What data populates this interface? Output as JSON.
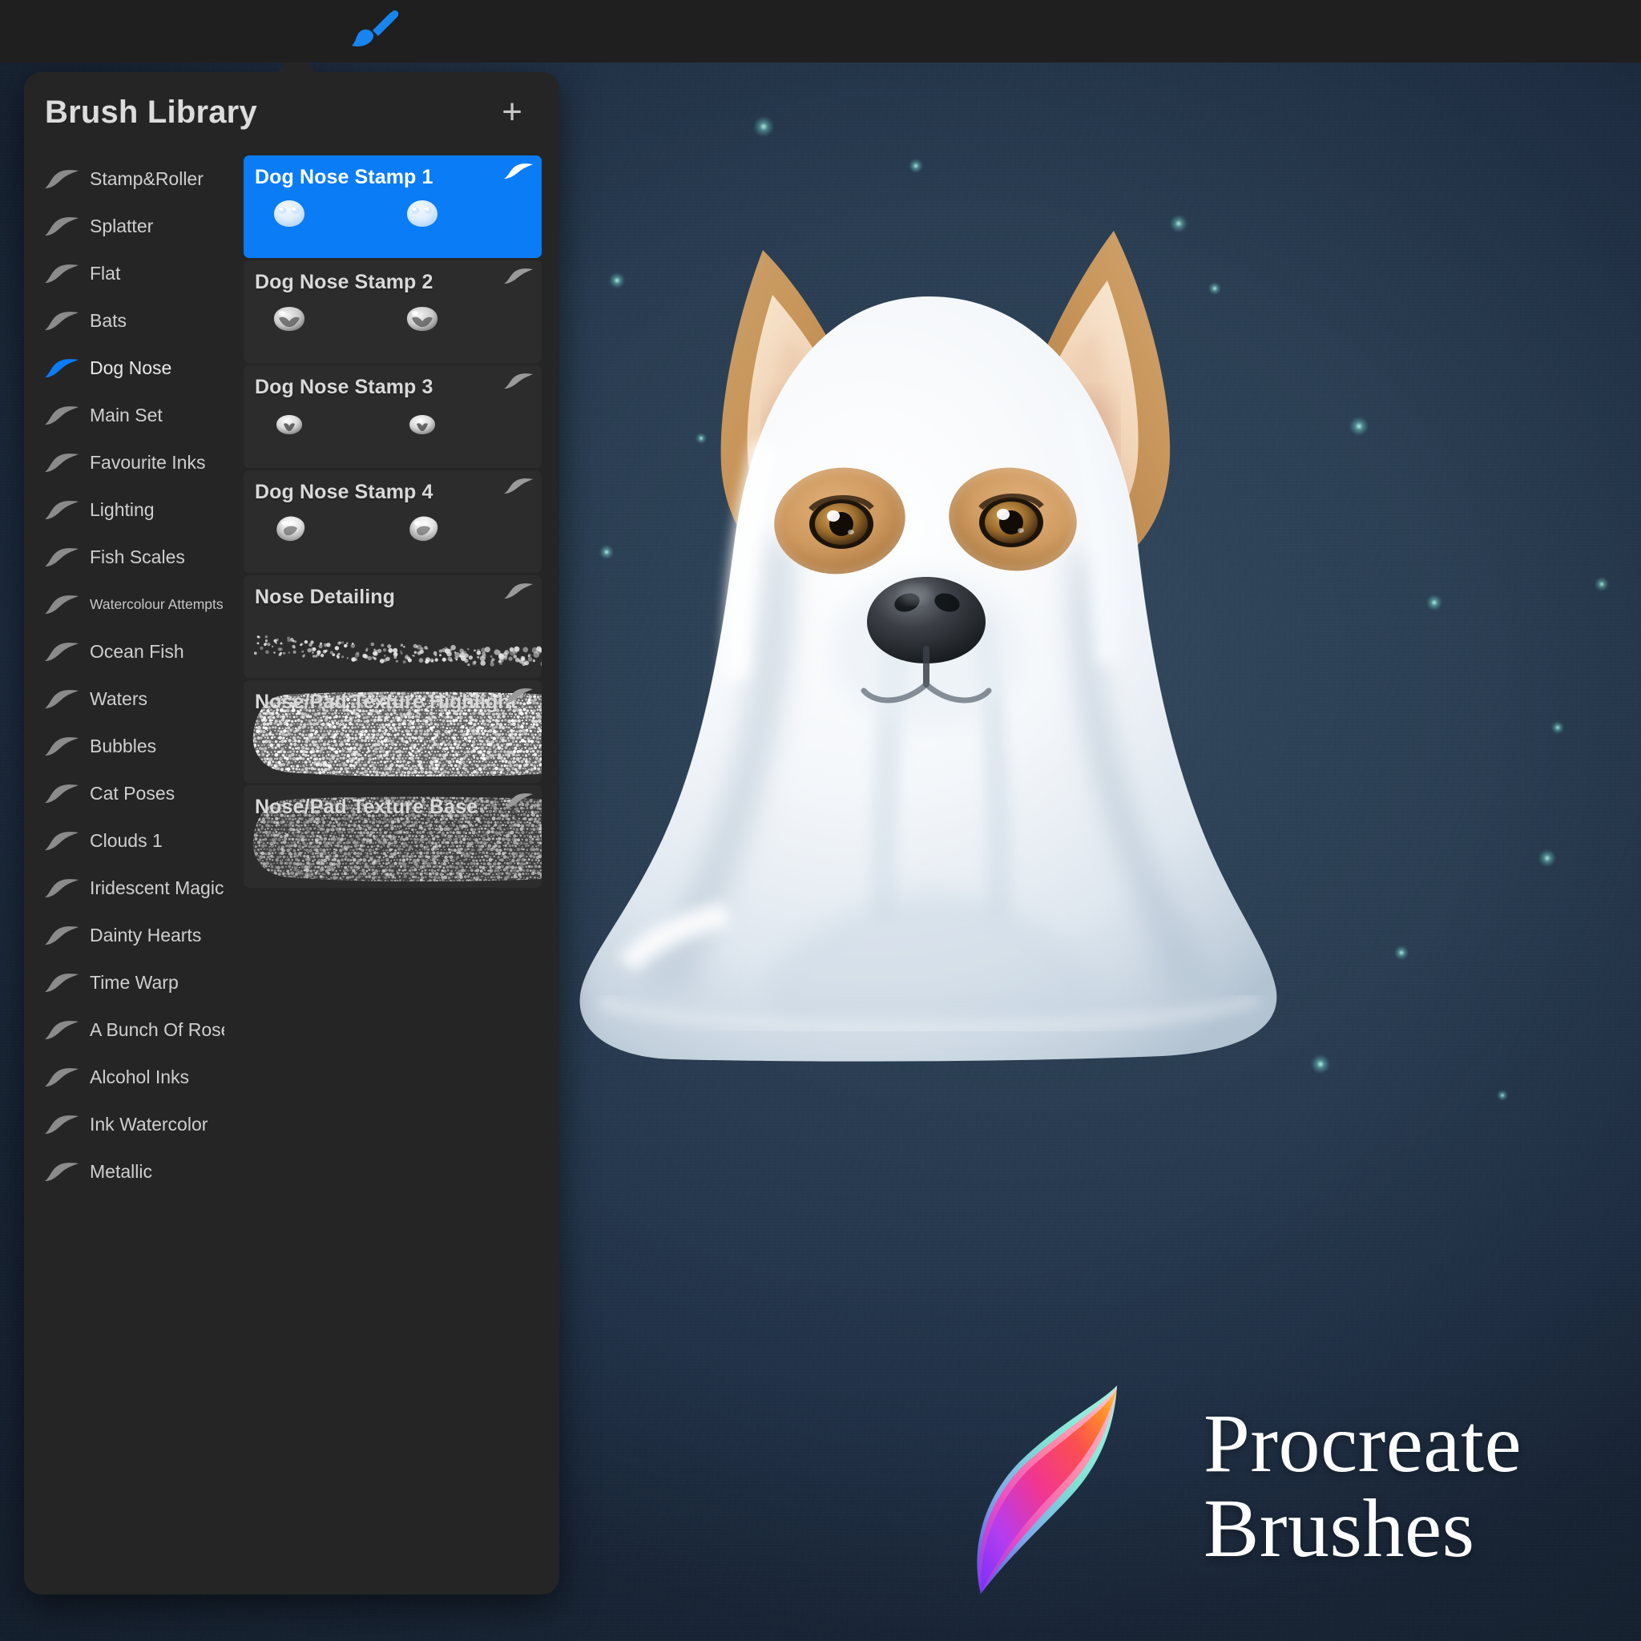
{
  "topbar": {
    "brush_tool_icon": "paintbrush-icon",
    "background": "#1f1f1f"
  },
  "panel": {
    "title": "Brush Library",
    "add_label": "+",
    "accent": "#0a7cf5",
    "background": "#252525"
  },
  "brush_sets": [
    {
      "label": "Stamp&Roller",
      "selected": false
    },
    {
      "label": "Splatter",
      "selected": false
    },
    {
      "label": "Flat",
      "selected": false
    },
    {
      "label": "Bats",
      "selected": false
    },
    {
      "label": "Dog Nose",
      "selected": true
    },
    {
      "label": "Main Set",
      "selected": false
    },
    {
      "label": "Favourite Inks",
      "selected": false
    },
    {
      "label": "Lighting",
      "selected": false
    },
    {
      "label": "Fish Scales",
      "selected": false
    },
    {
      "label": "Watercolour Attempts",
      "selected": false,
      "small": true
    },
    {
      "label": "Ocean Fish",
      "selected": false
    },
    {
      "label": "Waters",
      "selected": false
    },
    {
      "label": "Bubbles",
      "selected": false
    },
    {
      "label": "Cat Poses",
      "selected": false
    },
    {
      "label": "Clouds 1",
      "selected": false
    },
    {
      "label": "Iridescent Magic",
      "selected": false
    },
    {
      "label": "Dainty Hearts",
      "selected": false
    },
    {
      "label": "Time Warp",
      "selected": false
    },
    {
      "label": "A Bunch Of Roses",
      "selected": false
    },
    {
      "label": "Alcohol Inks",
      "selected": false
    },
    {
      "label": "Ink Watercolor",
      "selected": false
    },
    {
      "label": "Metallic",
      "selected": false
    }
  ],
  "brushes": [
    {
      "name": "Dog Nose Stamp 1",
      "selected": true,
      "thumb": "stamp-pair-soft"
    },
    {
      "name": "Dog Nose Stamp 2",
      "selected": false,
      "thumb": "stamp-pair-rough"
    },
    {
      "name": "Dog Nose Stamp 3",
      "selected": false,
      "thumb": "stamp-pair-small"
    },
    {
      "name": "Dog Nose Stamp 4",
      "selected": false,
      "thumb": "stamp-pair-blob"
    },
    {
      "name": "Nose Detailing",
      "selected": false,
      "thumb": "speckle-stroke"
    },
    {
      "name": "Nose/Pad Texture Highlight",
      "selected": false,
      "thumb": "texture-stroke-bright"
    },
    {
      "name": "Nose/Pad Texture Base",
      "selected": false,
      "thumb": "texture-stroke-dim"
    }
  ],
  "artwork": {
    "subject": "ghost-dog-illustration",
    "background_color": "#2a3d52"
  },
  "branding": {
    "logo": "procreate-logo-ribbon",
    "line1": "Procreate",
    "line2": "Brushes"
  }
}
